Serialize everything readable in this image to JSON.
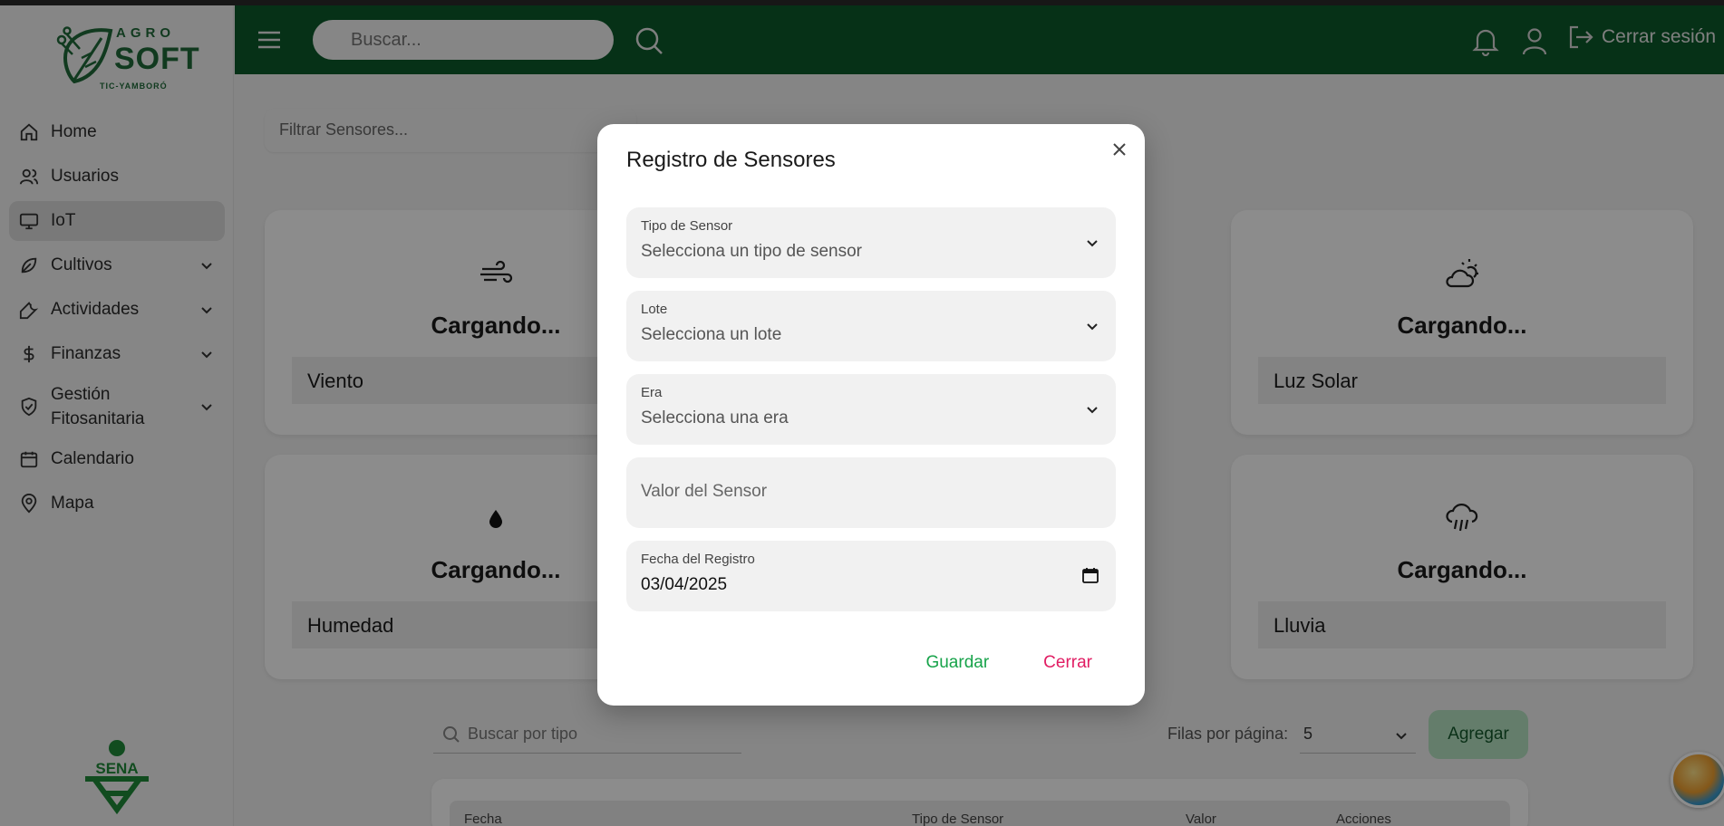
{
  "brand": {
    "agro": "AGRO",
    "soft": "SOFT",
    "tagline": "TIC-YAMBORÓ",
    "partner_logo": "SENA",
    "color_primary": "#0b5a2a"
  },
  "header": {
    "search_placeholder": "Buscar...",
    "logout_label": "Cerrar sesión"
  },
  "sidebar": {
    "items": [
      {
        "label": "Home",
        "icon": "home-icon"
      },
      {
        "label": "Usuarios",
        "icon": "users-icon"
      },
      {
        "label": "IoT",
        "icon": "monitor-icon",
        "active": true
      },
      {
        "label": "Cultivos",
        "icon": "leaf-icon",
        "expandable": true
      },
      {
        "label": "Actividades",
        "icon": "wrench-icon",
        "expandable": true
      },
      {
        "label": "Finanzas",
        "icon": "dollar-icon",
        "expandable": true
      },
      {
        "label": "Gestión Fitosanitaria",
        "line1": "Gestión",
        "line2": "Fitosanitaria",
        "icon": "shield-icon",
        "expandable": true
      },
      {
        "label": "Calendario",
        "icon": "calendar-icon"
      },
      {
        "label": "Mapa",
        "icon": "map-pin-icon"
      }
    ]
  },
  "main": {
    "filter_placeholder": "Filtrar Sensores...",
    "cards": [
      {
        "name": "Viento",
        "value": "Cargando...",
        "icon": "wind-icon"
      },
      {
        "name": "Luz Solar",
        "value": "Cargando...",
        "icon": "cloud-sun-icon"
      },
      {
        "name": "Humedad",
        "value": "Cargando...",
        "icon": "droplet-icon"
      },
      {
        "name": "Lluvia",
        "value": "Cargando...",
        "icon": "cloud-rain-icon"
      }
    ],
    "table_search_placeholder": "Buscar por tipo",
    "rows_per_page_label": "Filas por página:",
    "rows_per_page_value": "5",
    "add_button": "Agregar",
    "columns": [
      "Fecha",
      "Tipo de Sensor",
      "Valor",
      "Acciones"
    ]
  },
  "modal": {
    "title": "Registro de Sensores",
    "fields": {
      "sensor_type": {
        "label": "Tipo de Sensor",
        "value": "Selecciona un tipo de sensor"
      },
      "lote": {
        "label": "Lote",
        "value": "Selecciona un lote"
      },
      "era": {
        "label": "Era",
        "value": "Selecciona una era"
      },
      "sensor_value": {
        "placeholder": "Valor del Sensor"
      },
      "date": {
        "label": "Fecha del Registro",
        "value": "03/04/2025"
      }
    },
    "save_label": "Guardar",
    "close_label": "Cerrar",
    "save_color": "#17a34a",
    "close_color": "#e11d63"
  }
}
